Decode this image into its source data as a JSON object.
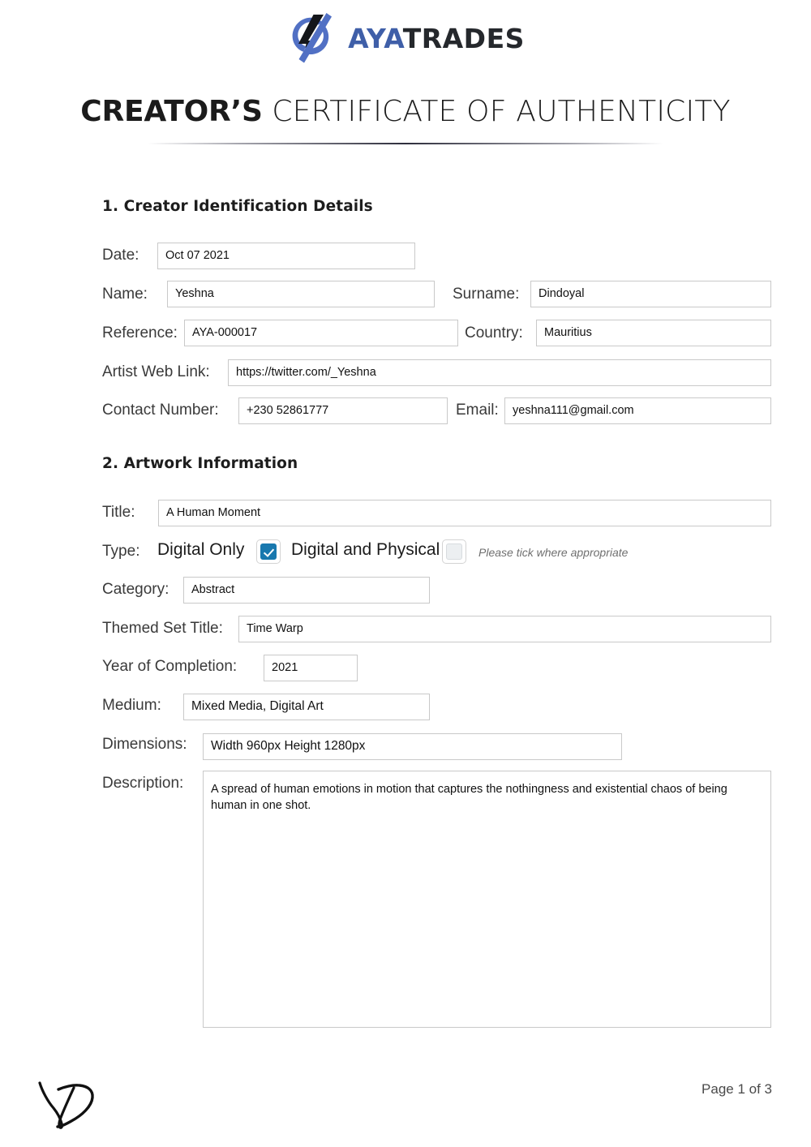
{
  "brand": {
    "logo_icon": "ayatrades-logo-icon",
    "name_primary": "AYA",
    "name_secondary": "TRADES",
    "primary_color": "#3f5fa8",
    "secondary_color": "#25282c"
  },
  "document": {
    "title_strong": "CREATOR’S",
    "title_light": " CERTIFICATE OF AUTHENTICITY"
  },
  "sections": {
    "creator": {
      "heading": "1. Creator Identification Details"
    },
    "artwork": {
      "heading": "2. Artwork Information"
    }
  },
  "creator_fields": {
    "date_label": "Date:",
    "date_value": "Oct 07 2021",
    "name_label": "Name:",
    "name_value": "Yeshna",
    "surname_label": "Surname:",
    "surname_value": "Dindoyal",
    "reference_label": "Reference:",
    "reference_value": "AYA-000017",
    "country_label": "Country:",
    "country_value": "Mauritius",
    "weblink_label": "Artist Web Link:",
    "weblink_value": "https://twitter.com/_Yeshna",
    "contact_label": "Contact Number:",
    "contact_value": "+230 52861777",
    "email_label": "Email:",
    "email_value": "yeshna111@gmail.com"
  },
  "artwork_fields": {
    "title_label": "Title:",
    "title_value": "A Human Moment",
    "type_label": "Type:",
    "type_option_1": "Digital Only",
    "type_option_2": "Digital and Physical",
    "type_hint": "Please tick where appropriate",
    "type_option_1_checked": true,
    "type_option_2_checked": false,
    "category_label": "Category:",
    "category_value": "Abstract",
    "themed_set_label": "Themed Set Title:",
    "themed_set_value": "Time Warp",
    "year_label": "Year of Completion:",
    "year_value": "2021",
    "medium_label": "Medium:",
    "medium_value": "Mixed Media, Digital Art",
    "dimensions_label": "Dimensions:",
    "dimensions_value": "Width 960px  Height 1280px",
    "description_label": "Description:",
    "description_value": "A spread of human emotions in motion that captures the nothingness and existential chaos of being human in one shot."
  },
  "footer": {
    "signature_icon": "handwritten-signature-yd",
    "page_number": "Page 1 of 3"
  },
  "checkbox_accent": "#1878ae"
}
